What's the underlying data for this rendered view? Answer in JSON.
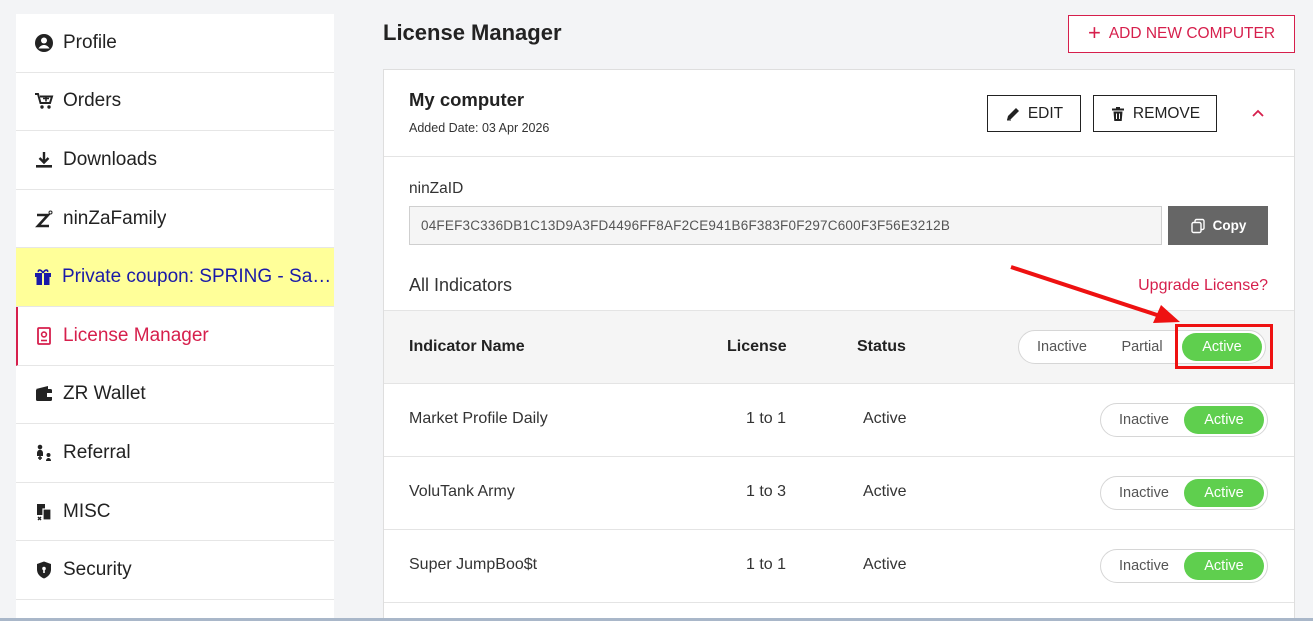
{
  "sidebar": {
    "items": [
      {
        "label": "Profile",
        "icon": "user-circle-icon"
      },
      {
        "label": "Orders",
        "icon": "cart-icon"
      },
      {
        "label": "Downloads",
        "icon": "download-icon"
      },
      {
        "label": "ninZaFamily",
        "icon": "ninza-logo-icon"
      },
      {
        "label": "Private coupon: SPRING - Save…",
        "icon": "gift-icon"
      },
      {
        "label": "License Manager",
        "icon": "license-icon"
      },
      {
        "label": "ZR Wallet",
        "icon": "wallet-icon"
      },
      {
        "label": "Referral",
        "icon": "referral-icon"
      },
      {
        "label": "MISC",
        "icon": "misc-icon"
      },
      {
        "label": "Security",
        "icon": "shield-icon"
      }
    ]
  },
  "main": {
    "title": "License Manager",
    "add_button": "ADD NEW COMPUTER",
    "computer": {
      "name": "My computer",
      "added_date": "Added Date: 03 Apr 2026",
      "edit_label": "EDIT",
      "remove_label": "REMOVE",
      "ninza_id_label": "ninZaID",
      "ninza_id_value": "04FEF3C336DB1C13D9A3FD4496FF8AF2CE941B6F383F0F297C600F3F56E3212B",
      "copy_label": "Copy"
    },
    "all_indicators_label": "All Indicators",
    "upgrade_label": "Upgrade License?",
    "table": {
      "headers": {
        "name": "Indicator Name",
        "license": "License",
        "status": "Status"
      },
      "header_toggle": {
        "inactive": "Inactive",
        "partial": "Partial",
        "active": "Active",
        "selected": "Active"
      },
      "rows": [
        {
          "name": "Market Profile Daily",
          "license": "1 to 1",
          "status": "Active",
          "toggle_inactive": "Inactive",
          "toggle_active": "Active"
        },
        {
          "name": "VoluTank Army",
          "license": "1 to 3",
          "status": "Active",
          "toggle_inactive": "Inactive",
          "toggle_active": "Active"
        },
        {
          "name": "Super JumpBoo$t",
          "license": "1 to 1",
          "status": "Active",
          "toggle_inactive": "Inactive",
          "toggle_active": "Active"
        }
      ]
    }
  },
  "colors": {
    "accent": "#d61f4c",
    "toggle_on": "#5fcf4e",
    "coupon_bg": "#ffff99",
    "coupon_text": "#1a1aa8",
    "annotation": "#ee1111"
  }
}
